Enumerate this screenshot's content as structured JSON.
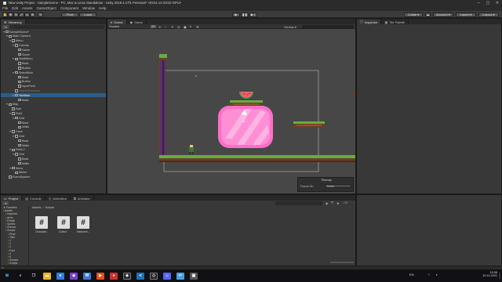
{
  "window": {
    "title": "New Unity Project - SampleScene - PC, Mac & Linux Standalone - Unity 2019.4.17f1 Personal* <DX11 on DX10 GPU>",
    "minimize_icon": "minimize-icon",
    "maximize_icon": "maximize-icon",
    "close_icon": "close-icon"
  },
  "menu": [
    "File",
    "Edit",
    "Assets",
    "GameObject",
    "Component",
    "Window",
    "Help"
  ],
  "toolbar": {
    "pivot": "Pivot",
    "local": "Local",
    "collab": "Collab ▾",
    "account": "Account ▾",
    "layers": "Layers ▾",
    "layout": "Layout ▾"
  },
  "hierarchy": {
    "tab": "Hierarchy",
    "items": [
      {
        "label": "SampleScene*",
        "depth": 0,
        "arrow": "▼"
      },
      {
        "label": "Main Camera",
        "depth": 1,
        "arrow": "▼"
      },
      {
        "label": "Menu",
        "depth": 2,
        "arrow": "▼"
      },
      {
        "label": "Canvas",
        "depth": 3,
        "arrow": "▼"
      },
      {
        "label": "Name",
        "depth": 4,
        "arrow": ""
      },
      {
        "label": "Score",
        "depth": 4,
        "arrow": ""
      },
      {
        "label": "StartMenu",
        "depth": 3,
        "arrow": "▼"
      },
      {
        "label": "Back",
        "depth": 4,
        "arrow": ""
      },
      {
        "label": "Button",
        "depth": 4,
        "arrow": ""
      },
      {
        "label": "SelectNick",
        "depth": 3,
        "arrow": "▼"
      },
      {
        "label": "Back",
        "depth": 4,
        "arrow": ""
      },
      {
        "label": "Button",
        "depth": 4,
        "arrow": ""
      },
      {
        "label": "InputField",
        "depth": 4,
        "arrow": ""
      },
      {
        "label": "SelectCharacter",
        "depth": 3,
        "arrow": ""
      },
      {
        "label": "YouWon",
        "depth": 3,
        "arrow": "▼"
      },
      {
        "label": "Back",
        "depth": 4,
        "arrow": ""
      },
      {
        "label": "Map",
        "depth": 1,
        "arrow": "▼"
      },
      {
        "label": "Kyle",
        "depth": 2,
        "arrow": ""
      },
      {
        "label": "Field",
        "depth": 2,
        "arrow": "▼"
      },
      {
        "label": "Grid",
        "depth": 3,
        "arrow": "▼"
      },
      {
        "label": "Back",
        "depth": 4,
        "arrow": ""
      },
      {
        "label": "Walls",
        "depth": 4,
        "arrow": ""
      },
      {
        "label": "Cave",
        "depth": 2,
        "arrow": "▼"
      },
      {
        "label": "Grid",
        "depth": 3,
        "arrow": "▼"
      },
      {
        "label": "Back",
        "depth": 4,
        "arrow": ""
      },
      {
        "label": "Walls",
        "depth": 4,
        "arrow": ""
      },
      {
        "label": "Field-2",
        "depth": 2,
        "arrow": "▼"
      },
      {
        "label": "Grid",
        "depth": 3,
        "arrow": "▼"
      },
      {
        "label": "Back",
        "depth": 4,
        "arrow": ""
      },
      {
        "label": "Walls",
        "depth": 4,
        "arrow": ""
      },
      {
        "label": "Items",
        "depth": 2,
        "arrow": "▼"
      },
      {
        "label": "Melon",
        "depth": 3,
        "arrow": ""
      },
      {
        "label": "EventSystem",
        "depth": 1,
        "arrow": ""
      }
    ]
  },
  "scene": {
    "tabs": [
      "Scene",
      "Game"
    ],
    "shading": "Shaded",
    "gizmos": "Gizmos ▾",
    "overlay": {
      "title": "Tilemap",
      "focus_label": "Focus On",
      "focus_value": "None"
    }
  },
  "inspector": {
    "tabs": [
      "Inspector",
      "Tile Palette"
    ]
  },
  "project": {
    "tabs": [
      "Project",
      "Console",
      "Animation",
      "Animator"
    ],
    "breadcrumb": [
      "Assets",
      "Scripts"
    ],
    "count": "17",
    "sidebar": [
      "Favorites",
      "Assets",
      "Imported",
      "Anim",
      "Prefab",
      "Sprites",
      "Scenes",
      "Scripts",
      "Pixel",
      "Tiles",
      "1",
      "2",
      "3",
      "Font",
      "4",
      "5",
      "Scenes",
      "Scripts"
    ],
    "files": [
      "Character...",
      "Collect",
      "Melonme..."
    ]
  },
  "status": {
    "icon": "warning-icon"
  },
  "taskbar": {
    "lang": "EN",
    "time": "15:38",
    "date": "15.11.2021"
  },
  "colors": {
    "accent_selection": "#2c5d87",
    "grass": "#62b13a",
    "dirt": "#6e3d2a",
    "pink": "#ff6ec7"
  }
}
